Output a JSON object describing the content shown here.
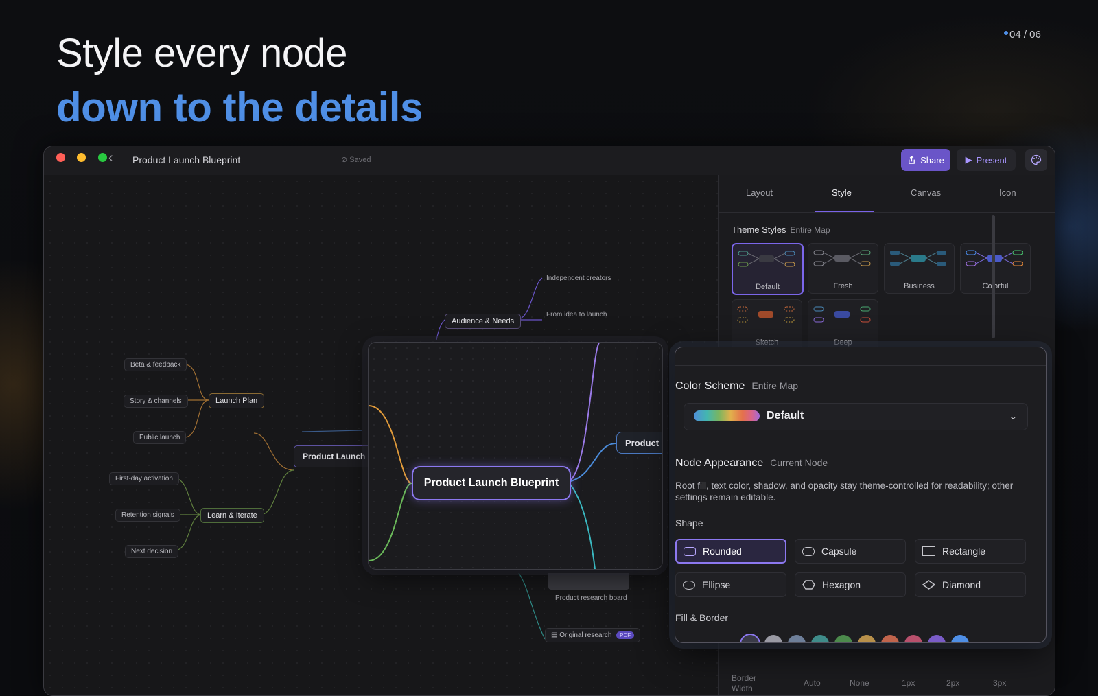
{
  "slide": {
    "title": "Style every node",
    "subtitle": "down to the details",
    "pager": "04 / 06"
  },
  "window": {
    "doc_title": "Product Launch Blueprint",
    "saved": "Saved",
    "share_label": "Share",
    "present_label": "Present"
  },
  "canvas": {
    "audience": "Audience & Needs",
    "audience_leaves": [
      "Independent creators",
      "From idea to launch"
    ],
    "launch_plan": "Launch Plan",
    "launch_leaves": [
      "Beta & feedback",
      "Story & channels",
      "Public launch"
    ],
    "learn": "Learn & Iterate",
    "learn_leaves": [
      "First-day activation",
      "Retention signals",
      "Next decision"
    ],
    "root_partial": "Product Launch",
    "research_board": "Product research board",
    "original_research": "Original research",
    "pdf_badge": "PDF"
  },
  "panel": {
    "tabs": [
      "Layout",
      "Style",
      "Canvas",
      "Icon"
    ],
    "active_tab": "Style",
    "theme_styles_label": "Theme Styles",
    "theme_styles_scope": "Entire Map",
    "themes": [
      "Default",
      "Fresh",
      "Business",
      "Colorful",
      "Sketch",
      "Deep"
    ],
    "border_width_label": "Border Width",
    "border_widths": [
      "Auto",
      "None",
      "1px",
      "2px",
      "3px"
    ]
  },
  "zoom_left": {
    "root": "Product Launch Blueprint",
    "right_node": "Product I"
  },
  "zoom_right": {
    "color_scheme_label": "Color Scheme",
    "color_scheme_scope": "Entire Map",
    "color_scheme_value": "Default",
    "node_appearance_label": "Node Appearance",
    "node_appearance_scope": "Current Node",
    "description": "Root fill, text color, shadow, and opacity stay theme-controlled for readability; other settings remain editable.",
    "shape_label": "Shape",
    "shapes": [
      "Rounded",
      "Capsule",
      "Rectangle",
      "Ellipse",
      "Hexagon",
      "Diamond"
    ],
    "active_shape": "Rounded",
    "fill_border_label": "Fill & Border",
    "fill_colors": [
      "#3a3a48",
      "#9a9aa4",
      "#6e7f9a",
      "#3f8c8a",
      "#4c8a4c",
      "#b8904a",
      "#c0644c",
      "#b8506c",
      "#7a5cc8",
      "#4f8fe6"
    ]
  },
  "colors": {
    "accent": "#7b66ea",
    "brand_blue": "#4f8fe6"
  }
}
